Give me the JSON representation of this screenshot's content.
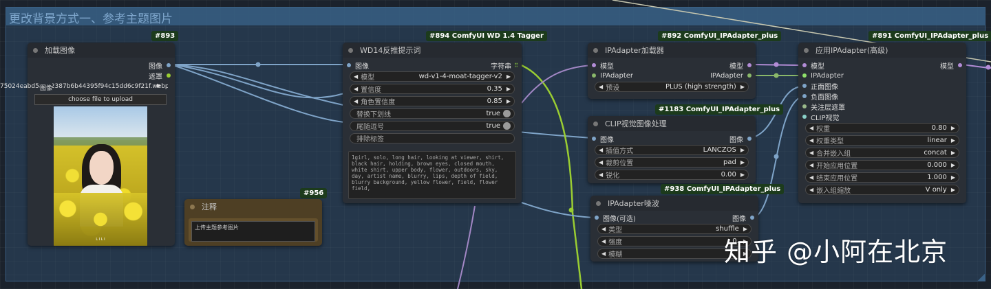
{
  "group": {
    "title": "更改背景方式一、参考主题图片"
  },
  "colors": {
    "image_wire": "#7fa4c8",
    "ipadapter_wire": "#a287c5",
    "clip_vision_wire": "#8ab86a",
    "string_wire": "#9acd32",
    "model_wire": "#b28cd6"
  },
  "nodes": {
    "load_image": {
      "badge": "#893",
      "title": "加载图像",
      "outputs": [
        "图像",
        "遮罩"
      ],
      "filename": "75024eabd5a2d2387b6b44395f94c15dd6c9f21f.webp",
      "filename_label": "图像",
      "upload_label": "choose file to upload",
      "preview_watermark": "L I L I"
    },
    "wd14": {
      "badge": "#894 ComfyUI WD 1.4 Tagger",
      "title": "WD14反推提示词",
      "input": "图像",
      "output": "字符串",
      "widgets": [
        {
          "label": "模型",
          "value": "wd-v1-4-moat-tagger-v2"
        },
        {
          "label": "置信度",
          "value": "0.35"
        },
        {
          "label": "角色置信度",
          "value": "0.85"
        }
      ],
      "toggles": [
        {
          "label": "替换下划线",
          "value": "true"
        },
        {
          "label": "尾随逗号",
          "value": "true"
        }
      ],
      "exclude_label": "排除标签",
      "tags_text": "1girl, solo, long hair, looking at viewer, shirt, black hair, holding, brown eyes, closed mouth, white shirt, upper body, flower, outdoors, sky, day, artist name, blurry, lips, depth of field, blurry background, yellow flower, field, flower field,"
    },
    "ipa_loader": {
      "badge": "#892 ComfyUI_IPAdapter_plus",
      "title": "IPAdapter加载器",
      "inputs": [
        "模型",
        "IPAdapter"
      ],
      "outputs": [
        "模型",
        "IPAdapter"
      ],
      "preset_label": "预设",
      "preset_value": "PLUS (high strength)"
    },
    "clip_vision": {
      "badge": "#1183 ComfyUI_IPAdapter_plus",
      "title": "CLIP视觉图像处理",
      "input": "图像",
      "output": "图像",
      "widgets": [
        {
          "label": "插值方式",
          "value": "LANCZOS"
        },
        {
          "label": "裁剪位置",
          "value": "pad"
        },
        {
          "label": "锐化",
          "value": "0.00"
        }
      ]
    },
    "noise": {
      "badge": "#938 ComfyUI_IPAdapter_plus",
      "title": "IPAdapter噪波",
      "input": "图像(可选)",
      "output": "图像",
      "widgets": [
        {
          "label": "类型",
          "value": "shuffle"
        },
        {
          "label": "强度",
          "value": "0."
        },
        {
          "label": "模糊",
          "value": ""
        }
      ]
    },
    "apply_ipa": {
      "badge": "#891 ComfyUI_IPAdapter_plus",
      "title": "应用IPAdapter(高级)",
      "inputs": [
        "模型",
        "IPAdapter",
        "正面图像",
        "负面图像",
        "关注层遮罩",
        "CLIP视觉"
      ],
      "output": "模型",
      "widgets": [
        {
          "label": "权重",
          "value": "0.80"
        },
        {
          "label": "权重类型",
          "value": "linear"
        },
        {
          "label": "合并嵌入组",
          "value": "concat"
        },
        {
          "label": "开始应用位置",
          "value": "0.000"
        },
        {
          "label": "结束应用位置",
          "value": "1.000"
        },
        {
          "label": "嵌入组缩放",
          "value": "V only"
        }
      ]
    },
    "note": {
      "badge": "#956",
      "title": "注释",
      "text": "上传主题参考图片"
    }
  },
  "watermark": "知乎 @小阿在北京"
}
